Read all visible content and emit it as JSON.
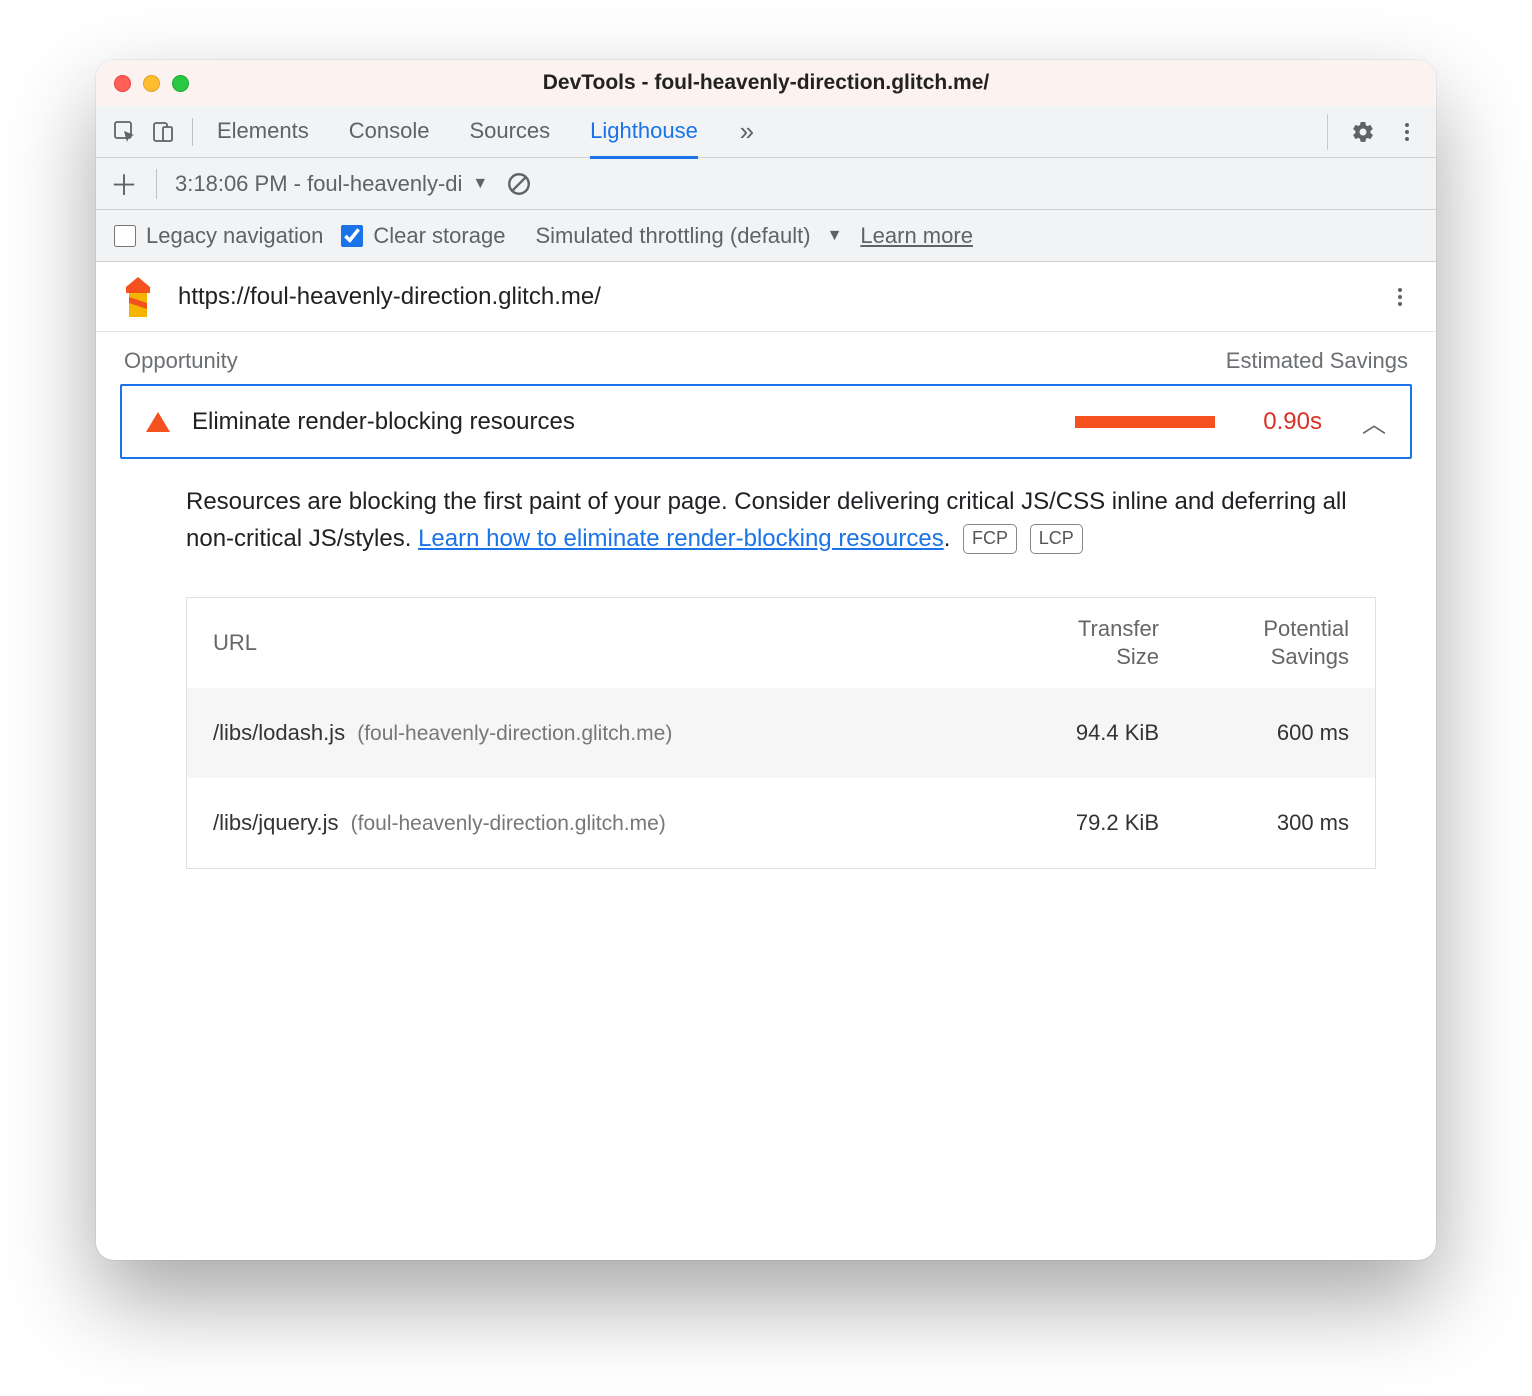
{
  "window": {
    "title": "DevTools - foul-heavenly-direction.glitch.me/"
  },
  "tabs": {
    "items": [
      "Elements",
      "Console",
      "Sources",
      "Lighthouse"
    ],
    "active_index": 3
  },
  "subbar": {
    "report_label": "3:18:06 PM - foul-heavenly-di"
  },
  "settings": {
    "legacy_label": "Legacy navigation",
    "legacy_checked": false,
    "clear_label": "Clear storage",
    "clear_checked": true,
    "throttling_label": "Simulated throttling (default)",
    "learn_more": "Learn more"
  },
  "report": {
    "url": "https://foul-heavenly-direction.glitch.me/",
    "opportunity_heading": "Opportunity",
    "estimated_heading": "Estimated Savings"
  },
  "audit": {
    "title": "Eliminate render-blocking resources",
    "display_value": "0.90s",
    "description_prefix": "Resources are blocking the first paint of your page. Consider delivering critical JS/CSS inline and deferring all non-critical JS/styles. ",
    "description_link": "Learn how to eliminate render-blocking resources",
    "description_suffix": ".",
    "metric_tags": [
      "FCP",
      "LCP"
    ],
    "table": {
      "headers": {
        "url": "URL",
        "size": "Transfer Size",
        "savings": "Potential Savings"
      },
      "rows": [
        {
          "path": "/libs/lodash.js",
          "host": "(foul-heavenly-direction.glitch.me)",
          "size": "94.4 KiB",
          "savings": "600 ms"
        },
        {
          "path": "/libs/jquery.js",
          "host": "(foul-heavenly-direction.glitch.me)",
          "size": "79.2 KiB",
          "savings": "300 ms"
        }
      ]
    }
  }
}
